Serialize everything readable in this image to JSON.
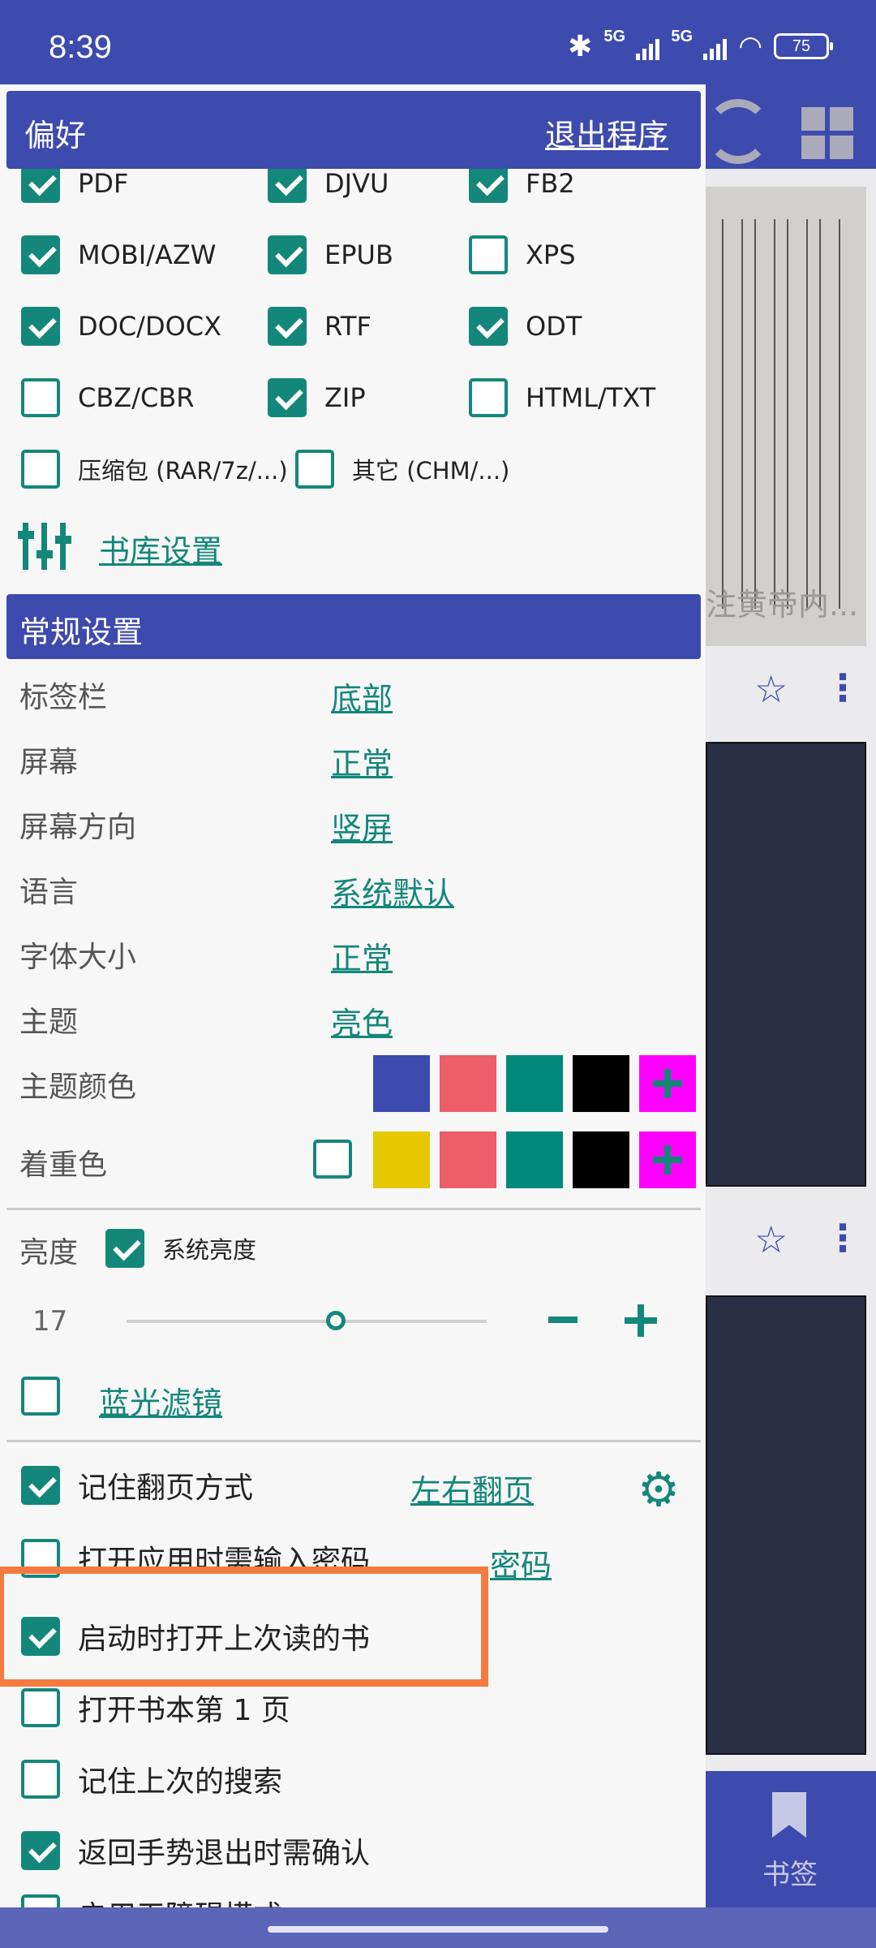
{
  "status_bar": {
    "time": "8:39",
    "signal1": "5G",
    "signal2": "5G",
    "battery": "75"
  },
  "panel": {
    "title": "偏好",
    "exit": "退出程序"
  },
  "formats": [
    {
      "label": "PDF",
      "checked": true
    },
    {
      "label": "DJVU",
      "checked": true
    },
    {
      "label": "FB2",
      "checked": true
    },
    {
      "label": "MOBI/AZW",
      "checked": true
    },
    {
      "label": "EPUB",
      "checked": true
    },
    {
      "label": "XPS",
      "checked": false
    },
    {
      "label": "DOC/DOCX",
      "checked": true
    },
    {
      "label": "RTF",
      "checked": true
    },
    {
      "label": "ODT",
      "checked": true
    },
    {
      "label": "CBZ/CBR",
      "checked": false
    },
    {
      "label": "ZIP",
      "checked": true
    },
    {
      "label": "HTML/TXT",
      "checked": false
    },
    {
      "label": "压缩包 (RAR/7z/...)",
      "checked": false
    },
    {
      "label": "其它 (CHM/...)",
      "checked": false
    }
  ],
  "library_settings": "书库设置",
  "general": {
    "title": "常规设置",
    "rows": [
      {
        "label": "标签栏",
        "value": "底部"
      },
      {
        "label": "屏幕",
        "value": "正常"
      },
      {
        "label": "屏幕方向",
        "value": "竖屏"
      },
      {
        "label": "语言",
        "value": "系统默认"
      },
      {
        "label": "字体大小",
        "value": "正常"
      },
      {
        "label": "主题",
        "value": "亮色"
      }
    ],
    "theme_color_label": "主题颜色",
    "theme_colors": [
      "#3d4aae",
      "#ec5c69",
      "#00897b",
      "#000000"
    ],
    "accent_label": "着重色",
    "accent_colors": [
      "#e6c800",
      "#ec5c69",
      "#00897b",
      "#000000"
    ],
    "add_color": "#ff00ff",
    "accent_teal": "#13877a"
  },
  "brightness": {
    "label": "亮度",
    "system": "系统亮度",
    "system_checked": true,
    "value": "17",
    "level_fraction": 0.58
  },
  "blue_light": {
    "label": "蓝光滤镜",
    "checked": false
  },
  "options": [
    {
      "label": "记住翻页方式",
      "checked": true,
      "link": "左右翻页"
    },
    {
      "label": "打开应用时需输入密码",
      "checked": false,
      "link": "密码"
    },
    {
      "label": "启动时打开上次读的书",
      "checked": true
    },
    {
      "label": "打开书本第 1 页",
      "checked": false
    },
    {
      "label": "记住上次的搜索",
      "checked": false
    },
    {
      "label": "返回手势退出时需确认",
      "checked": true
    },
    {
      "label": "启用无障碍模式",
      "checked": false
    }
  ],
  "background": {
    "book_title": "注黄帝内...",
    "bookmark_tab": "书签"
  }
}
